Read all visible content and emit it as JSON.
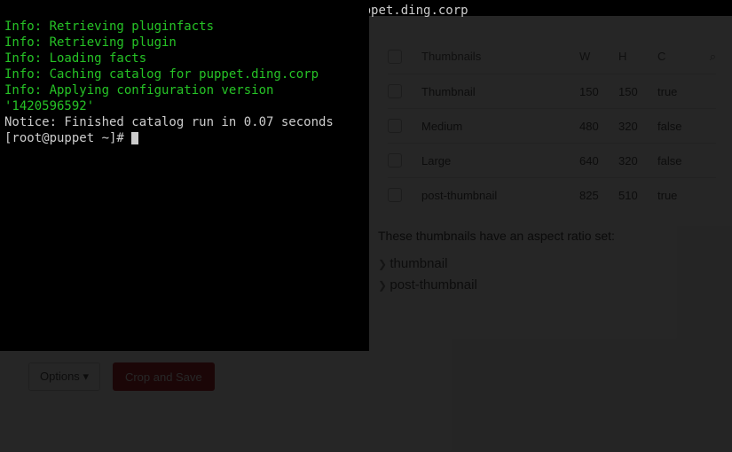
{
  "terminal": {
    "prompt1": "[root@puppet ~]# ",
    "cmd": "puppet agent --test --server puppet.ding.corp",
    "lines": [
      "Info: Retrieving pluginfacts",
      "Info: Retrieving plugin",
      "Info: Loading facts",
      "Info: Caching catalog for puppet.ding.corp",
      "Info: Applying configuration version '1420596592'"
    ],
    "notice": "Notice: Finished catalog run in 0.07 seconds",
    "prompt2": "[root@puppet ~]# "
  },
  "table": {
    "head": {
      "name": "Thumbnails",
      "w": "W",
      "h": "H",
      "c": "C"
    },
    "rows": [
      {
        "name": "Thumbnail",
        "w": "150",
        "h": "150",
        "c": "true"
      },
      {
        "name": "Medium",
        "w": "480",
        "h": "320",
        "c": "false"
      },
      {
        "name": "Large",
        "w": "640",
        "h": "320",
        "c": "false"
      },
      {
        "name": "post-thumbnail",
        "w": "825",
        "h": "510",
        "c": "true"
      }
    ]
  },
  "aspect": {
    "heading": "These thumbnails have an aspect ratio set:",
    "items": [
      "thumbnail",
      "post-thumbnail"
    ]
  },
  "buttons": {
    "options": "Options",
    "crop": "Crop and Save"
  },
  "icons": {
    "search": "⌕",
    "caret": "▾"
  }
}
